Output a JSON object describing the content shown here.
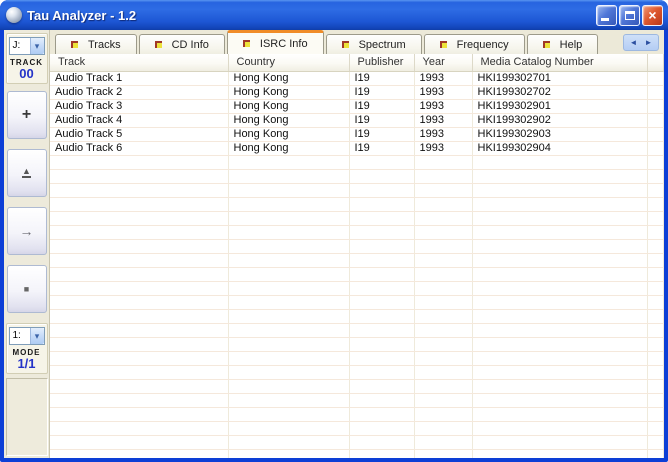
{
  "window": {
    "title": "Tau Analyzer - 1.2",
    "controls": {
      "minimize": "minimize",
      "maximize": "maximize",
      "close": "close"
    }
  },
  "colors": {
    "titlebar_blue": "#1d56d4",
    "window_border": "#0D3FD6",
    "active_tab_accent": "#F08C28",
    "panel_beige": "#ECE9D8",
    "value_blue": "#2433C8",
    "tab_flag_yellow": "#EDE23A",
    "tab_flag_red": "#A03828"
  },
  "tabs": [
    {
      "label": "Tracks",
      "active": false
    },
    {
      "label": "CD Info",
      "active": false
    },
    {
      "label": "ISRC Info",
      "active": true
    },
    {
      "label": "Spectrum",
      "active": false
    },
    {
      "label": "Frequency",
      "active": false
    },
    {
      "label": "Help",
      "active": false
    }
  ],
  "tab_scroller": {
    "left": "◄",
    "right": "►"
  },
  "sidebar": {
    "drive_combo": {
      "value": "J:",
      "chevron": "▾"
    },
    "track_label": "TRACK",
    "track_value": "00",
    "buttons": [
      {
        "name": "add",
        "glyph": "+"
      },
      {
        "name": "eject",
        "glyph": "▲"
      },
      {
        "name": "next",
        "glyph": "→"
      },
      {
        "name": "stop",
        "glyph": "■"
      }
    ],
    "mode_combo": {
      "value": "1:",
      "chevron": "▾"
    },
    "mode_label": "MODE",
    "mode_value": "1/1"
  },
  "table": {
    "columns": [
      "Track",
      "Country",
      "Publisher",
      "Year",
      "Media Catalog Number"
    ],
    "rows": [
      [
        "Audio Track 1",
        "Hong Kong",
        "I19",
        "1993",
        "HKI199302701"
      ],
      [
        "Audio Track 2",
        "Hong Kong",
        "I19",
        "1993",
        "HKI199302702"
      ],
      [
        "Audio Track 3",
        "Hong Kong",
        "I19",
        "1993",
        "HKI199302901"
      ],
      [
        "Audio Track 4",
        "Hong Kong",
        "I19",
        "1993",
        "HKI199302902"
      ],
      [
        "Audio Track 5",
        "Hong Kong",
        "I19",
        "1993",
        "HKI199302903"
      ],
      [
        "Audio Track 6",
        "Hong Kong",
        "I19",
        "1993",
        "HKI199302904"
      ]
    ]
  }
}
